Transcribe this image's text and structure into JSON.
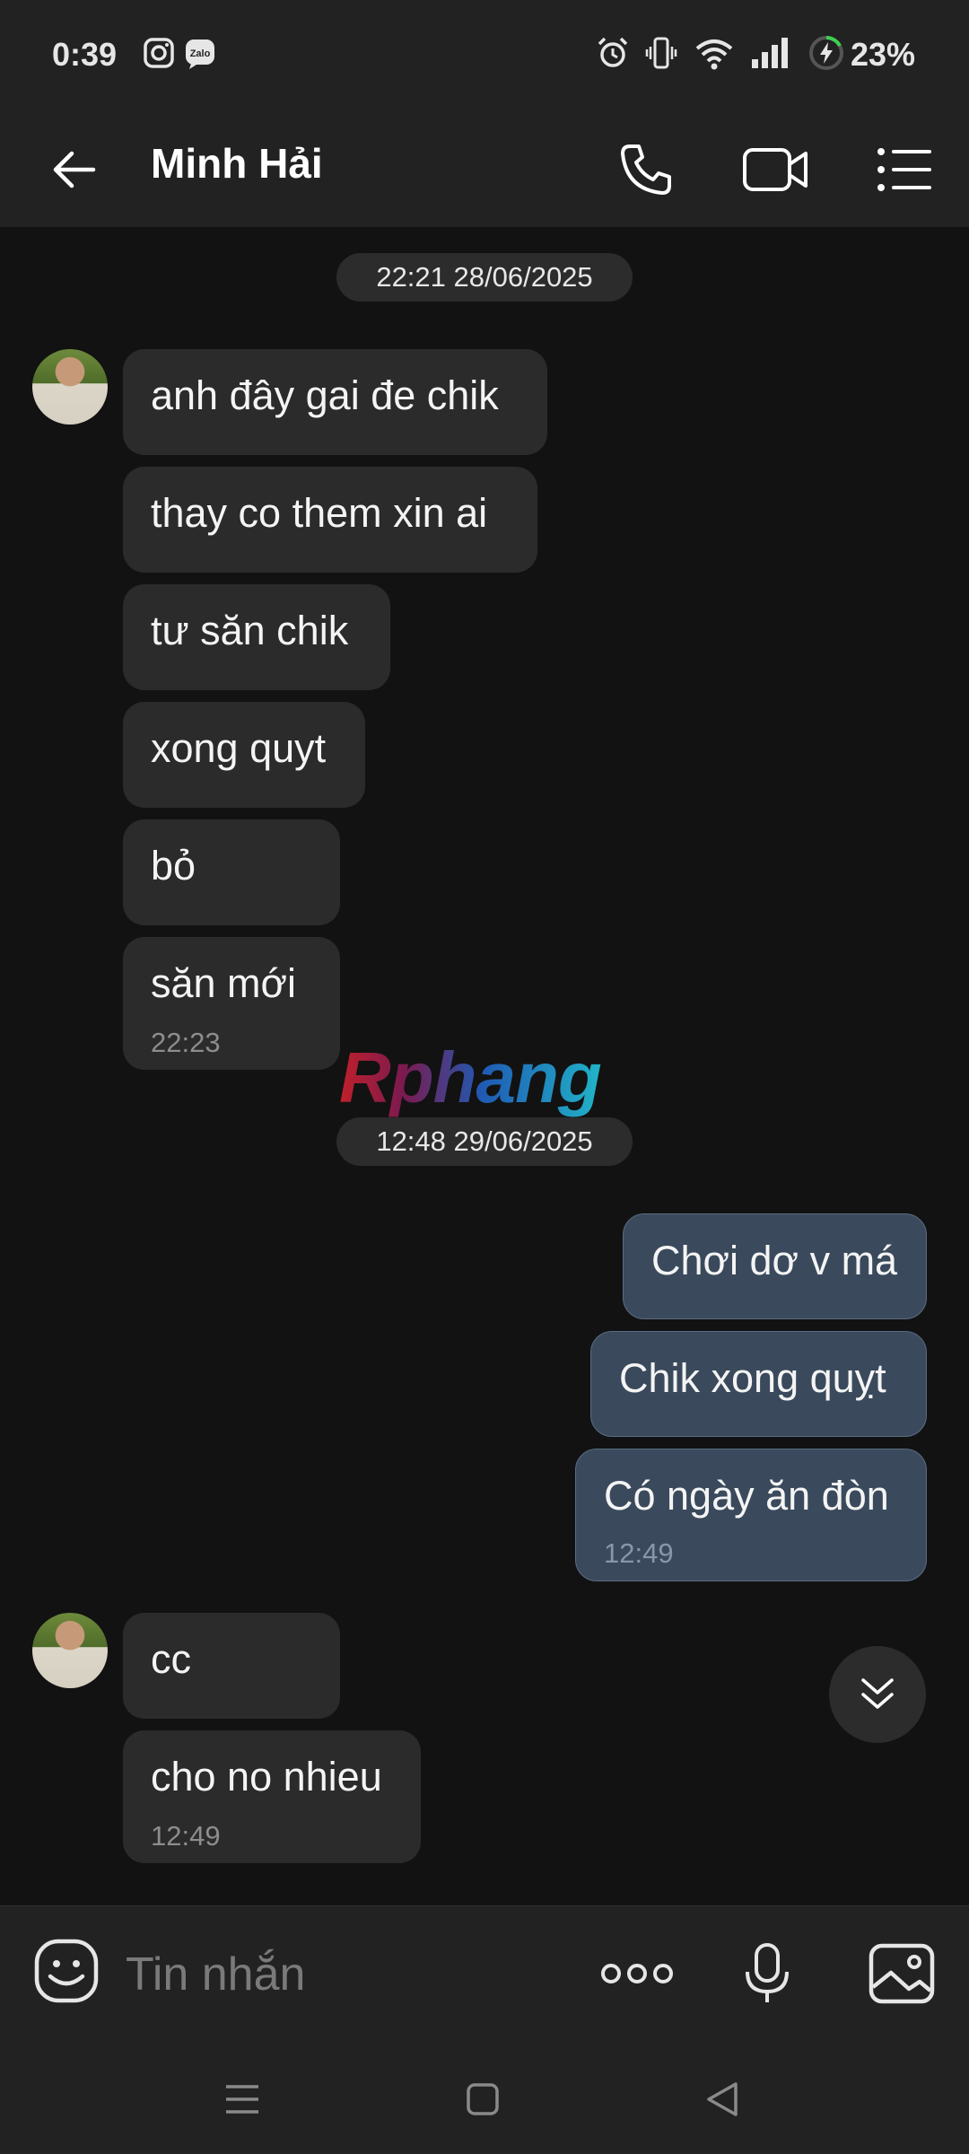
{
  "status_bar": {
    "time": "0:39",
    "battery": "23%",
    "icons": [
      "instagram-icon",
      "zalo-icon",
      "alarm-icon",
      "vibrate-icon",
      "wifi-icon",
      "signal-icon",
      "battery-charging-icon"
    ]
  },
  "header": {
    "contact_name": "Minh Hải",
    "icons": [
      "back-arrow-icon",
      "phone-icon",
      "video-call-icon",
      "menu-list-icon"
    ]
  },
  "chat": {
    "date_separators": [
      "22:21 28/06/2025",
      "12:48 29/06/2025"
    ],
    "messages": [
      {
        "from": "contact",
        "text": "anh đây gai đe chik"
      },
      {
        "from": "contact",
        "text": "thay co them xin ai"
      },
      {
        "from": "contact",
        "text": "tư săn chik"
      },
      {
        "from": "contact",
        "text": "xong quyt"
      },
      {
        "from": "contact",
        "text": "bỏ"
      },
      {
        "from": "contact",
        "text": "săn mới",
        "time": "22:23"
      },
      {
        "from": "me",
        "text": "Chơi dơ v má"
      },
      {
        "from": "me",
        "text": "Chik xong quỵt"
      },
      {
        "from": "me",
        "text": "Có ngày ăn đòn",
        "time": "12:49"
      },
      {
        "from": "contact",
        "text": "cc"
      },
      {
        "from": "contact",
        "text": "cho no nhieu",
        "time": "12:49"
      }
    ],
    "watermark": "Rphang"
  },
  "composer": {
    "placeholder": "Tin nhắn",
    "icons": [
      "emoji-sticker-icon",
      "more-dots-icon",
      "microphone-icon",
      "image-gallery-icon"
    ]
  },
  "colors": {
    "background": "#121212",
    "bar": "#222222",
    "incoming_bubble": "#2b2b2b",
    "outgoing_bubble": "#3a4a5c",
    "outgoing_border": "#596c82"
  }
}
